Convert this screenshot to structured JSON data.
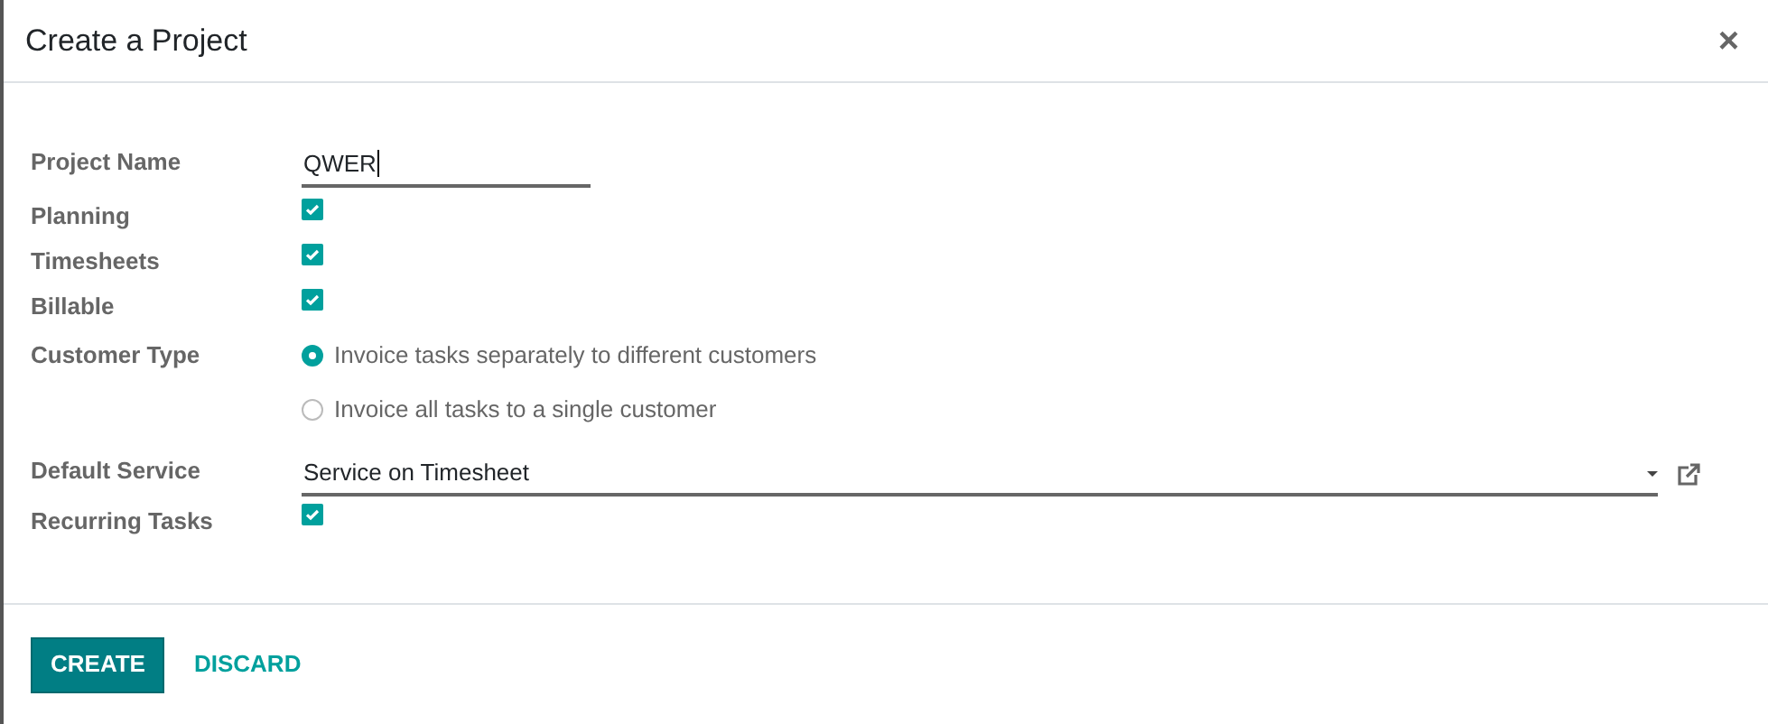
{
  "dialog": {
    "title": "Create a Project",
    "close": "×"
  },
  "fields": [
    {
      "kind": "text",
      "label": "Project Name",
      "value": "QWER"
    },
    {
      "kind": "checkbox",
      "label": "Planning",
      "checked": true
    },
    {
      "kind": "checkbox",
      "label": "Timesheets",
      "checked": true
    },
    {
      "kind": "checkbox",
      "label": "Billable",
      "checked": true
    },
    {
      "kind": "radio",
      "label": "Customer Type",
      "options": [
        {
          "label": "Invoice tasks separately to different customers",
          "selected": true
        },
        {
          "label": "Invoice all tasks to a single customer",
          "selected": false
        }
      ]
    },
    {
      "kind": "select",
      "label": "Default Service",
      "value": "Service on Timesheet"
    },
    {
      "kind": "checkbox",
      "label": "Recurring Tasks",
      "checked": true
    }
  ],
  "buttons": [
    {
      "kind": "primary",
      "label": "CREATE"
    },
    {
      "kind": "link",
      "label": "DISCARD"
    }
  ]
}
